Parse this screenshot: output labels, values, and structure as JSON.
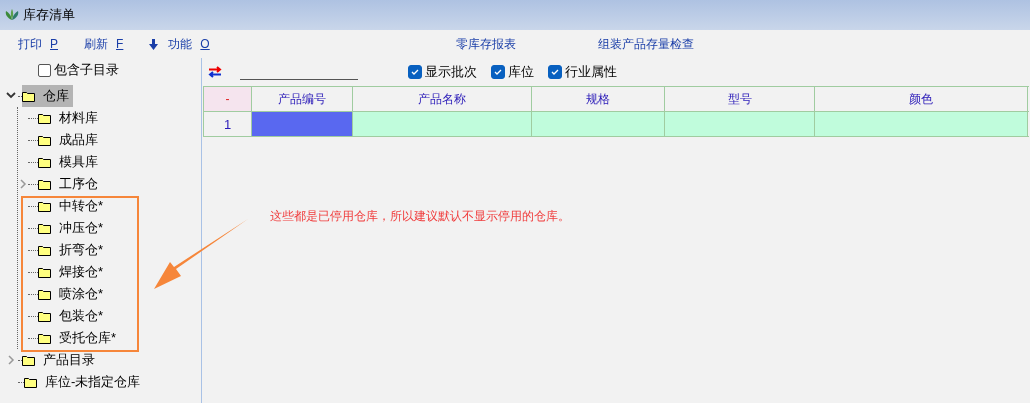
{
  "window": {
    "title": "库存清单"
  },
  "toolbar": [
    {
      "label": "打印",
      "key": "P",
      "kind": "link"
    },
    {
      "label": "刷新",
      "key": "F",
      "kind": "link"
    },
    {
      "label": "功能",
      "key": "O",
      "kind": "menu"
    }
  ],
  "report_links": [
    "零库存报表",
    "组装产品存量检查"
  ],
  "include_subfolders": {
    "label": "包含子目录",
    "checked": false
  },
  "tree": [
    {
      "label": "仓库",
      "selected": true,
      "expanded": true,
      "children": [
        {
          "label": "材料库",
          "selected": false
        },
        {
          "label": "成品库",
          "selected": false
        },
        {
          "label": "模具库",
          "selected": false
        },
        {
          "label": "工序仓",
          "selected": false,
          "expanded": false,
          "has_children": true
        },
        {
          "label": "中转仓*",
          "selected": false
        },
        {
          "label": "冲压仓*",
          "selected": false
        },
        {
          "label": "折弯仓*",
          "selected": false
        },
        {
          "label": "焊接仓*",
          "selected": false
        },
        {
          "label": "喷涂仓*",
          "selected": false
        },
        {
          "label": "包装仓*",
          "selected": false
        },
        {
          "label": "受托仓库*",
          "selected": false
        }
      ]
    },
    {
      "label": "产品目录",
      "selected": false,
      "expanded": false,
      "has_children": true
    },
    {
      "label": "库位-未指定仓库",
      "selected": false
    }
  ],
  "options": [
    {
      "label": "显示批次",
      "checked": true
    },
    {
      "label": "库位",
      "checked": true
    },
    {
      "label": "行业属性",
      "checked": true
    }
  ],
  "table": {
    "columns": [
      "-",
      "产品编号",
      "产品名称",
      "规格",
      "型号",
      "颜色"
    ],
    "rows": [
      {
        "number": "1",
        "cells": [
          {
            "selected": true
          },
          {
            "selected": false
          },
          {
            "selected": false
          },
          {
            "selected": false
          },
          {
            "selected": false
          }
        ]
      }
    ]
  },
  "annotation": {
    "text": "这些都是已停用仓库，所以建议默认不显示停用的仓库。"
  }
}
